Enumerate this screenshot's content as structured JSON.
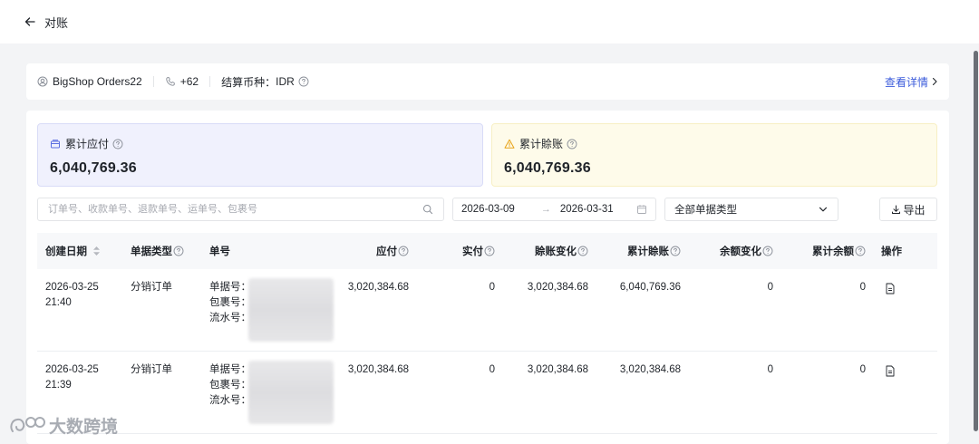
{
  "header": {
    "title": "对账"
  },
  "info": {
    "shop_name": "BigShop Orders22",
    "phone": "+62",
    "currency_label": "结算币种：",
    "currency": "IDR",
    "detail_link": "查看详情"
  },
  "stats": {
    "payable": {
      "label": "累计应付",
      "value": "6,040,769.36"
    },
    "offset": {
      "label": "累计賒账",
      "value": "6,040,769.36"
    }
  },
  "filters": {
    "search_placeholder": "订单号、收款单号、退款单号、运单号、包裹号",
    "date_start": "2026-03-09",
    "date_end": "2026-03-31",
    "date_sep": "→",
    "type_select": "全部单据类型",
    "export_label": "导出"
  },
  "table": {
    "headers": {
      "created": "创建日期",
      "type": "单据类型",
      "no": "单号",
      "payable": "应付",
      "paid": "实付",
      "offset_change": "賒账变化",
      "cum_offset": "累计賒账",
      "balance_change": "余额变化",
      "cum_balance": "累计余额",
      "action": "操作"
    },
    "no_labels": {
      "doc": "单据号：",
      "package": "包裹号：",
      "serial": "流水号："
    },
    "rows": [
      {
        "date": "2026-03-25",
        "time": "21:40",
        "type": "分销订单",
        "payable": "3,020,384.68",
        "paid": "0",
        "offset_change": "3,020,384.68",
        "cum_offset": "6,040,769.36",
        "balance_change": "0",
        "cum_balance": "0"
      },
      {
        "date": "2026-03-25",
        "time": "21:39",
        "type": "分销订单",
        "payable": "3,020,384.68",
        "paid": "0",
        "offset_change": "3,020,384.68",
        "cum_offset": "3,020,384.68",
        "balance_change": "0",
        "cum_balance": "0"
      }
    ]
  },
  "watermark": {
    "text": "大数跨境"
  },
  "colors": {
    "accent": "#3b5bdb",
    "payable_bg": "#f0f1fd",
    "offset_bg": "#fefbea",
    "warning": "#e8a317"
  }
}
